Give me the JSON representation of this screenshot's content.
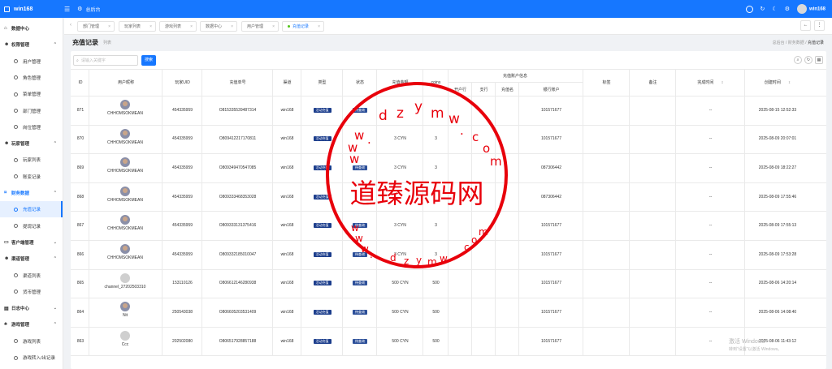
{
  "topbar": {
    "app_name": "win168",
    "home_label": "总后台",
    "username": "win168"
  },
  "sidebar": {
    "groups": [
      {
        "label": "数据中心",
        "icon": "home-icon"
      },
      {
        "label": "权限管理",
        "icon": "users-icon",
        "items": [
          "用户管理",
          "角色管理",
          "菜单管理",
          "部门管理",
          "岗位管理"
        ]
      },
      {
        "label": "玩家管理",
        "icon": "user-group-icon",
        "items": [
          "玩家列表",
          "账变记录"
        ]
      },
      {
        "label": "财务数据",
        "icon": "money-icon",
        "items": [
          "充值记录",
          "提现记录"
        ]
      },
      {
        "label": "客户端管理",
        "icon": "monitor-icon"
      },
      {
        "label": "渠道管理",
        "icon": "channel-icon",
        "items": [
          "渠道列表",
          "货币管理"
        ]
      },
      {
        "label": "日志中心",
        "icon": "log-icon"
      },
      {
        "label": "游戏管理",
        "icon": "game-icon",
        "items": [
          "游戏列表",
          "游戏转入/出记录"
        ]
      }
    ]
  },
  "tabs": [
    "部门管理",
    "玩家列表",
    "游戏列表",
    "数据中心",
    "用户管理",
    "充值记录"
  ],
  "page": {
    "title": "充值记录",
    "subtitle": "列表",
    "breadcrumb": [
      "总后台",
      "财务数据",
      "充值记录"
    ]
  },
  "search": {
    "placeholder": "请输入关键字",
    "button": "搜索"
  },
  "table": {
    "headers": {
      "id": "ID",
      "nick": "用户昵称",
      "uid": "玩家UID",
      "order": "充值单号",
      "channel": "渠道",
      "type": "类型",
      "status": "状态",
      "amount": "充值金额",
      "coins": "coins",
      "bank_group": "充值账户信息",
      "bank": "开户行",
      "branch": "支行",
      "holder": "充值名",
      "account": "银行账户",
      "tag": "标签",
      "remark": "备注",
      "done": "完成时间",
      "created": "创建时间"
    },
    "rows": [
      {
        "id": "871",
        "nick": "CHHOMSOKMEAN",
        "uid": "454335959",
        "order": "O815335539487314",
        "channel": "win168",
        "type": "活动充值",
        "status": "待查询",
        "amount": "",
        "coins": "",
        "account": "101571677",
        "done": "--",
        "created": "2025-08-15 12:52:33",
        "avatar": "img"
      },
      {
        "id": "870",
        "nick": "CHHOMSOKMEAN",
        "uid": "454335959",
        "order": "O809412217170811",
        "channel": "win168",
        "type": "活动充值",
        "status": "",
        "amount": "3 CYN",
        "coins": "3",
        "account": "101571677",
        "done": "--",
        "created": "2025-08-09 20:07:01",
        "avatar": "img"
      },
      {
        "id": "869",
        "nick": "CHHOMSOKMEAN",
        "uid": "454335959",
        "order": "O809349470547085",
        "channel": "win168",
        "type": "活动充值",
        "status": "待查询",
        "amount": "3 CYN",
        "coins": "3",
        "account": "087306442",
        "done": "--",
        "created": "2025-08-09 18:22:27",
        "avatar": "img"
      },
      {
        "id": "868",
        "nick": "CHHOMSOKMEAN",
        "uid": "454335959",
        "order": "O809333468353028",
        "channel": "win168",
        "type": "活动充值",
        "status": "",
        "amount": "",
        "coins": "",
        "account": "087306442",
        "done": "--",
        "created": "2025-08-09 17:55:46",
        "avatar": "img"
      },
      {
        "id": "867",
        "nick": "CHHOMSOKMEAN",
        "uid": "454335959",
        "order": "O809333131375416",
        "channel": "win168",
        "type": "活动充值",
        "status": "待查询",
        "amount": "3 CYN",
        "coins": "3",
        "account": "101571677",
        "done": "--",
        "created": "2025-08-09 17:55:13",
        "avatar": "img"
      },
      {
        "id": "866",
        "nick": "CHHOMSOKMEAN",
        "uid": "454335959",
        "order": "O809332185010047",
        "channel": "win168",
        "type": "活动充值",
        "status": "待查询",
        "amount": "3 CYN",
        "coins": "3",
        "account": "101571677",
        "done": "--",
        "created": "2025-08-09 17:53:28",
        "avatar": "img"
      },
      {
        "id": "865",
        "nick": "channel_27202503310",
        "uid": "153110126",
        "order": "O806612146280938",
        "channel": "win168",
        "type": "活动充值",
        "status": "待查询",
        "amount": "500 CYN",
        "coins": "500",
        "account": "101571677",
        "done": "--",
        "created": "2025-08-06 14:20:14",
        "avatar": "gray"
      },
      {
        "id": "864",
        "nick": "Nit",
        "uid": "250543038",
        "order": "O806605203531409",
        "channel": "win168",
        "type": "活动充值",
        "status": "待查询",
        "amount": "500 CYN",
        "coins": "500",
        "account": "101571677",
        "done": "--",
        "created": "2025-08-06 14:08:40",
        "avatar": "img"
      },
      {
        "id": "863",
        "nick": "Ccc",
        "uid": "202502080",
        "order": "O806517928857188",
        "channel": "win168",
        "type": "活动充值",
        "status": "待查询",
        "amount": "500 CYN",
        "coins": "500",
        "account": "101571677",
        "done": "--",
        "created": "2025-08-06 11:43:12",
        "avatar": "gray"
      }
    ]
  },
  "watermark": {
    "seal_text": "道臻源码网",
    "domain_letters": [
      "w",
      "w",
      "w",
      ".",
      "d",
      "z",
      "y",
      "m",
      "w",
      ".",
      "c",
      "o",
      "m"
    ]
  },
  "windows": {
    "line1": "激活 Windows",
    "line2": "转到\"设置\"以激活 Windows。"
  },
  "colors": {
    "primary": "#1677ff",
    "seal": "#e8000b",
    "tag": "#1b3d8c"
  }
}
